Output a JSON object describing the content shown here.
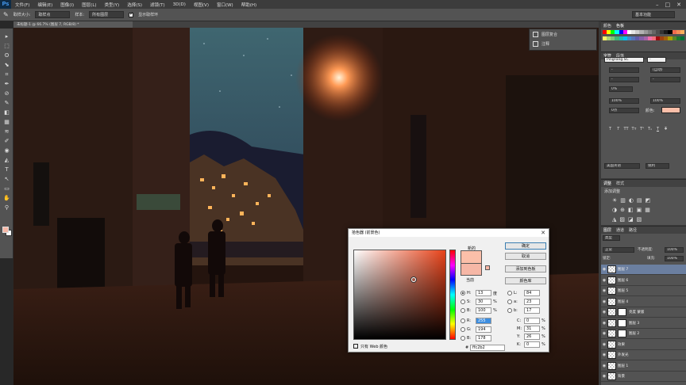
{
  "app": {
    "logo": "Ps"
  },
  "menubar": {
    "items": [
      "文件(F)",
      "编辑(E)",
      "图像(I)",
      "图层(L)",
      "类型(Y)",
      "选择(S)",
      "滤镜(T)",
      "3D(D)",
      "视图(V)",
      "窗口(W)",
      "帮助(H)"
    ],
    "controls": [
      "–",
      "□",
      "✕"
    ]
  },
  "options_bar": {
    "tool_icon": "eyedropper-icon",
    "sample_size_label": "取样大小:",
    "sample_size_value": "取样点",
    "sample_label": "样本:",
    "sample_value": "所有图层",
    "show_ring_label": "显示取样环",
    "workspace": "基本功能"
  },
  "document_tab": {
    "title": "未标题-1 @ 66.7% (图层 7, RGB/8) *"
  },
  "tools": [
    "▸",
    "⬚",
    "ʘ",
    "⬊",
    "⌗",
    "✒",
    "⊘",
    "✎",
    "◧",
    "▦",
    "≋",
    "✐",
    "◉",
    "◭",
    "T",
    "↖",
    "▭",
    "✋",
    "⚲"
  ],
  "float_panel": {
    "rows": [
      "图层复合",
      "注释"
    ]
  },
  "color_panel": {
    "tabs": [
      "颜色",
      "色板"
    ],
    "swatches": [
      "#ff0000",
      "#ffff00",
      "#00ff00",
      "#00ffff",
      "#0000ff",
      "#ff00ff",
      "#ffffff",
      "#e6e6e6",
      "#cccccc",
      "#b3b3b3",
      "#999999",
      "#808080",
      "#666666",
      "#4d4d4d",
      "#333333",
      "#1a1a1a",
      "#000000",
      "#f26c4f",
      "#f68e55",
      "#fbaf5d",
      "#fff467",
      "#acd372",
      "#7cc576",
      "#3bb878",
      "#1abbb4",
      "#00bff3",
      "#438ccb",
      "#5574b9",
      "#605ca8",
      "#855fa8",
      "#a763a8",
      "#f06ea9",
      "#f26d7d",
      "#9e0b0f",
      "#a0410d",
      "#a36209",
      "#aba000",
      "#598527",
      "#1a7b30",
      "#007236"
    ]
  },
  "character_panel": {
    "tabs": [
      "字符",
      "段落"
    ],
    "font_family": "PingFang SC",
    "font_style": "-",
    "fields": [
      "-",
      "-",
      "-",
      "-",
      "(自动)",
      "0%",
      "100%",
      "0点",
      "100%"
    ],
    "color_label": "颜色:",
    "style_buttons": [
      "T",
      "T",
      "TT",
      "Tт",
      "T¹",
      "T₁",
      "T",
      "T"
    ],
    "lang": "美国英语",
    "aa": "锐利"
  },
  "adjustments_panel": {
    "tabs": [
      "调整",
      "样式"
    ],
    "title": "添加调整"
  },
  "layers_panel": {
    "tabs": [
      "图层",
      "通道",
      "路径"
    ],
    "kind_label": "类型",
    "blend_mode": "正常",
    "opacity_label": "不透明度:",
    "opacity": "100%",
    "lock_label": "锁定:",
    "fill_label": "填充:",
    "fill": "100%",
    "layers": [
      {
        "name": "图层 7",
        "selected": true,
        "mask": false
      },
      {
        "name": "图层 6",
        "selected": false,
        "mask": false
      },
      {
        "name": "图层 5",
        "selected": false,
        "mask": false
      },
      {
        "name": "图层 4",
        "selected": false,
        "mask": false
      },
      {
        "name": "亮度 蒙版",
        "selected": false,
        "mask": true
      },
      {
        "name": "图层 3",
        "selected": false,
        "mask": true
      },
      {
        "name": "图层 2",
        "selected": false,
        "mask": true
      },
      {
        "name": "效果",
        "selected": false,
        "mask": false
      },
      {
        "name": "外发光",
        "selected": false,
        "mask": false
      },
      {
        "name": "图层 1",
        "selected": false,
        "mask": false
      },
      {
        "name": "背景",
        "selected": false,
        "mask": false
      }
    ]
  },
  "color_picker": {
    "title": "拾色器 (前景色)",
    "new_label": "新的",
    "current_label": "当前",
    "new_color": "#fbbfa9",
    "current_color": "#f6b7a6",
    "buttons": {
      "ok": "确定",
      "cancel": "取消",
      "add_swatch": "添加到色板",
      "libraries": "颜色库"
    },
    "hsb": {
      "H": "13",
      "S": "30",
      "B": "100",
      "H_unit": "度",
      "S_unit": "%",
      "B_unit": "%"
    },
    "rgb": {
      "R": "255",
      "G": "194",
      "B": "178"
    },
    "lab": {
      "L": "84",
      "a": "23",
      "b": "17"
    },
    "cmyk": {
      "C": "0",
      "M": "31",
      "Y": "26",
      "K": "0",
      "unit": "%"
    },
    "hex_label": "#",
    "hex": "ffc2b2",
    "web_only": "只有 Web 颜色"
  }
}
